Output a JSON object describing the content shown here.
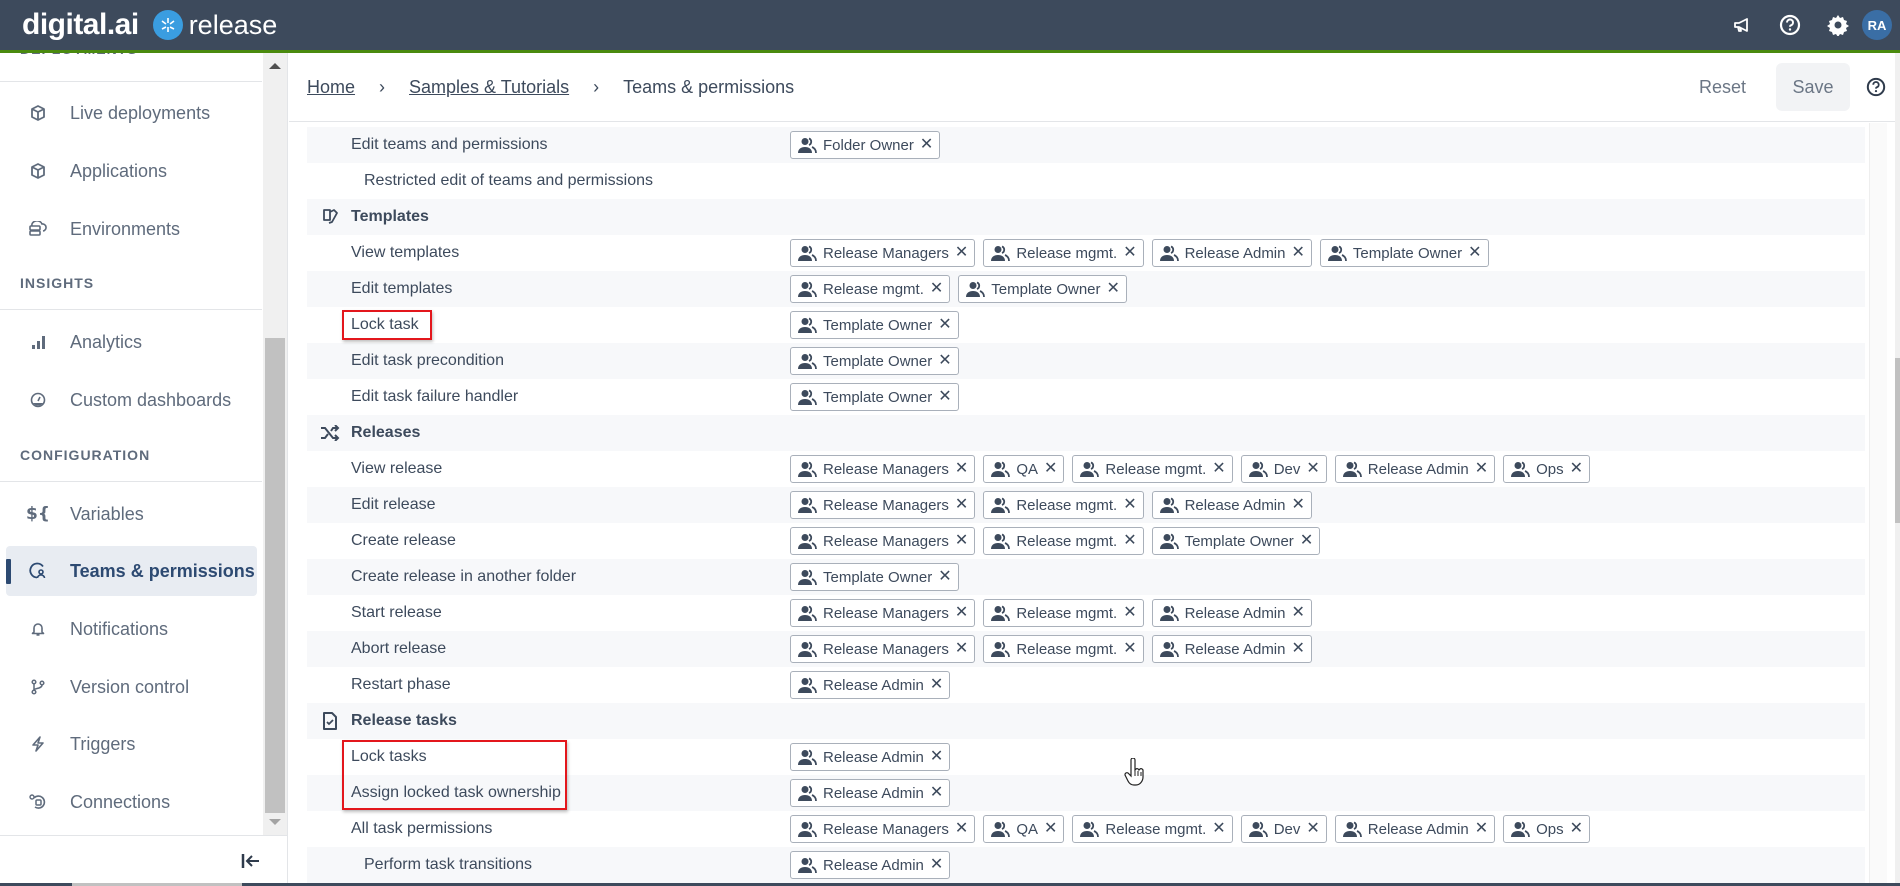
{
  "app": {
    "brand": "digital.ai",
    "product": "release",
    "user_initials": "RA"
  },
  "topbar_icons": [
    "announcement-icon",
    "help-icon",
    "settings-icon"
  ],
  "sidebar": {
    "sections": {
      "deployments": "DEPLOYMENTS",
      "insights": "INSIGHTS",
      "configuration": "CONFIGURATION"
    },
    "items": [
      {
        "label": "Live deployments",
        "icon": "cube-icon"
      },
      {
        "label": "Applications",
        "icon": "cube-icon"
      },
      {
        "label": "Environments",
        "icon": "server-icon"
      },
      {
        "label": "Analytics",
        "icon": "bar-chart-icon"
      },
      {
        "label": "Custom dashboards",
        "icon": "dashboard-gauge-icon"
      },
      {
        "label": "Variables",
        "icon": "variables-icon"
      },
      {
        "label": "Teams & permissions",
        "icon": "teams-icon",
        "active": true
      },
      {
        "label": "Notifications",
        "icon": "bell-icon"
      },
      {
        "label": "Version control",
        "icon": "git-branch-icon"
      },
      {
        "label": "Triggers",
        "icon": "lightning-icon"
      },
      {
        "label": "Connections",
        "icon": "plug-icon"
      }
    ]
  },
  "breadcrumb": {
    "home": "Home",
    "folder": "Samples & Tutorials",
    "current": "Teams & permissions",
    "separator": "›"
  },
  "actions": {
    "reset": "Reset",
    "save": "Save"
  },
  "permissions": {
    "rows": [
      {
        "type": "perm",
        "label": "Edit teams and permissions",
        "teams": [
          "Folder Owner"
        ]
      },
      {
        "type": "perm",
        "label": "Restricted edit of teams and permissions",
        "sub": true,
        "teams": []
      },
      {
        "type": "section",
        "label": "Templates",
        "icon": "template-icon"
      },
      {
        "type": "perm",
        "label": "View templates",
        "teams": [
          "Release Managers",
          "Release mgmt.",
          "Release Admin",
          "Template Owner"
        ]
      },
      {
        "type": "perm",
        "label": "Edit templates",
        "teams": [
          "Release mgmt.",
          "Template Owner"
        ]
      },
      {
        "type": "perm",
        "label": "Lock task",
        "highlighted": true,
        "teams": [
          "Template Owner"
        ]
      },
      {
        "type": "perm",
        "label": "Edit task precondition",
        "teams": [
          "Template Owner"
        ]
      },
      {
        "type": "perm",
        "label": "Edit task failure handler",
        "teams": [
          "Template Owner"
        ]
      },
      {
        "type": "section",
        "label": "Releases",
        "icon": "shuffle-icon"
      },
      {
        "type": "perm",
        "label": "View release",
        "teams": [
          "Release Managers",
          "QA",
          "Release mgmt.",
          "Dev",
          "Release Admin",
          "Ops"
        ]
      },
      {
        "type": "perm",
        "label": "Edit release",
        "teams": [
          "Release Managers",
          "Release mgmt.",
          "Release Admin"
        ]
      },
      {
        "type": "perm",
        "label": "Create release",
        "teams": [
          "Release Managers",
          "Release mgmt.",
          "Template Owner"
        ]
      },
      {
        "type": "perm",
        "label": "Create release in another folder",
        "teams": [
          "Template Owner"
        ]
      },
      {
        "type": "perm",
        "label": "Start release",
        "teams": [
          "Release Managers",
          "Release mgmt.",
          "Release Admin"
        ]
      },
      {
        "type": "perm",
        "label": "Abort release",
        "teams": [
          "Release Managers",
          "Release mgmt.",
          "Release Admin"
        ]
      },
      {
        "type": "perm",
        "label": "Restart phase",
        "teams": [
          "Release Admin"
        ]
      },
      {
        "type": "section",
        "label": "Release tasks",
        "icon": "task-file-icon"
      },
      {
        "type": "perm",
        "label": "Lock tasks",
        "highlighted": true,
        "teams": [
          "Release Admin"
        ]
      },
      {
        "type": "perm",
        "label": "Assign locked task ownership",
        "highlighted": true,
        "teams": [
          "Release Admin"
        ]
      },
      {
        "type": "perm",
        "label": "All task permissions",
        "teams": [
          "Release Managers",
          "QA",
          "Release mgmt.",
          "Dev",
          "Release Admin",
          "Ops"
        ]
      },
      {
        "type": "perm",
        "label": "Perform task transitions",
        "sub": true,
        "teams": [
          "Release Admin"
        ]
      }
    ]
  },
  "colors": {
    "topbar": "#3d4a5c",
    "accent_green": "#4a8a0e",
    "highlight_red": "#e3161c",
    "active_nav": "#2d4a72"
  }
}
